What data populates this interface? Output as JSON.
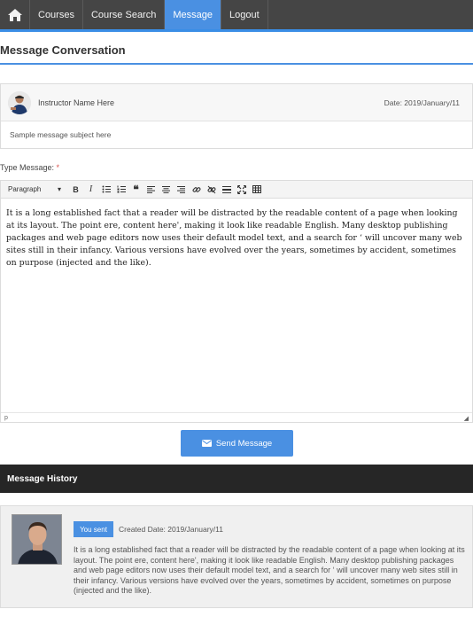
{
  "nav": {
    "home_icon": "home-icon",
    "items": [
      {
        "label": "Courses",
        "active": false
      },
      {
        "label": "Course Search",
        "active": false
      },
      {
        "label": "Message",
        "active": true
      },
      {
        "label": "Logout",
        "active": false
      }
    ]
  },
  "page": {
    "title": "Message Conversation"
  },
  "conversation": {
    "instructor_name": "Instructor Name Here",
    "date": "Date: 2019/January/11",
    "subject": "Sample message subject here"
  },
  "compose": {
    "label": "Type Message:",
    "required_mark": "*",
    "toolbar": {
      "format": "Paragraph",
      "buttons": [
        "bold-icon",
        "italic-icon",
        "bulleted-list-icon",
        "numbered-list-icon",
        "blockquote-icon",
        "align-left-icon",
        "align-center-icon",
        "align-right-icon",
        "link-icon",
        "unlink-icon",
        "horizontal-rule-icon",
        "fullscreen-icon",
        "table-icon"
      ]
    },
    "body": "It is a long established fact that a reader will be distracted by the readable content of a page when looking at its layout. The point ere, content here', making it look like readable English. Many desktop publishing packages and web page editors now uses their default model text, and a search for ‘ will uncover many web sites still in their infancy. Various versions have evolved over the years, sometimes by accident, sometimes on purpose (injected and the like).",
    "status_path": "p",
    "send_label": "Send Message"
  },
  "history": {
    "title": "Message History",
    "items": [
      {
        "badge": "You sent",
        "created": "Created Date: 2019/January/11",
        "text": "It is a long established fact that a reader will be distracted by the readable content of a page when looking at its layout. The point ere, content here', making it look like readable English. Many desktop publishing packages and web page editors now uses their default model text, and a search for ‘ will uncover many web sites still in their infancy. Various versions have evolved over the years, sometimes by accident, sometimes on purpose (injected and the like)."
      }
    ]
  },
  "colors": {
    "accent": "#4a90e2",
    "navbar": "#454545",
    "history_bar": "#262626"
  }
}
